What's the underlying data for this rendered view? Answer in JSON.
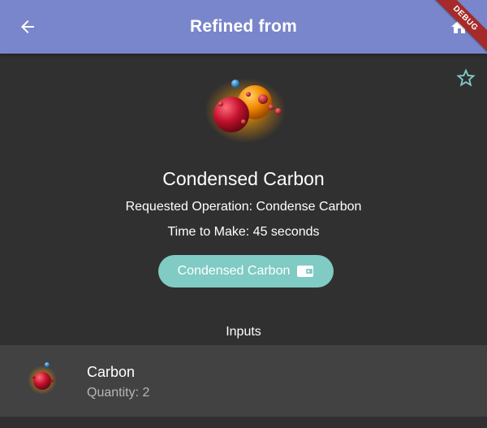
{
  "appbar": {
    "title": "Refined from",
    "back_icon": "arrow-back-icon",
    "home_icon": "home-icon",
    "color": "#7986cb"
  },
  "debug_banner": "DEBUG",
  "item": {
    "name": "Condensed Carbon",
    "operation": "Requested Operation: Condense Carbon",
    "time": "Time to Make: 45 seconds",
    "icon": "condensed-carbon-molecule-icon",
    "favorite_icon": "star-outline-icon"
  },
  "chip": {
    "label": "Condensed Carbon",
    "icon": "wallet-icon",
    "color": "#80cbc4"
  },
  "inputs": {
    "header": "Inputs",
    "items": [
      {
        "name": "Carbon",
        "quantity": "Quantity: 2",
        "icon": "carbon-atom-icon"
      }
    ]
  },
  "colors": {
    "background": "#303030",
    "row_background": "#424242",
    "debug": "#a52a2a"
  }
}
